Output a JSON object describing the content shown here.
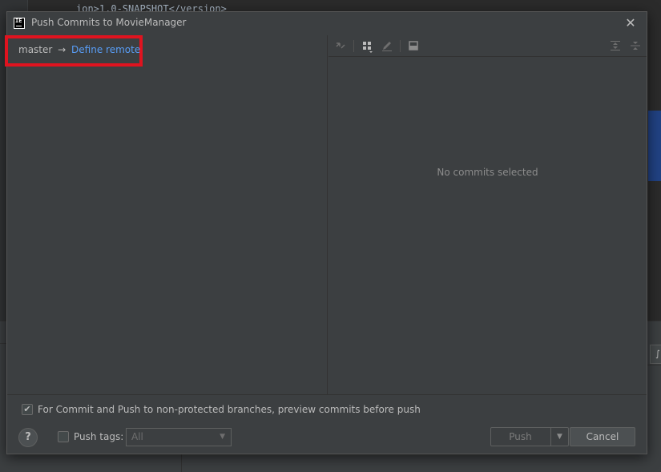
{
  "background": {
    "code_line": "ion>1.0-SNAPSHOT</version>"
  },
  "dialog": {
    "title": "Push Commits to MovieManager",
    "app_icon_text": "IE",
    "close_glyph": "✕"
  },
  "push_tree": {
    "branch": "master",
    "arrow": "→",
    "define_remote": "Define remote"
  },
  "details": {
    "empty_text": "No commits selected",
    "toolbar_icons": [
      "collapse-arrows-icon",
      "group-by-icon",
      "edit-icon",
      "preview-diff-icon",
      "expand-all-icon",
      "collapse-all-icon"
    ]
  },
  "options": {
    "preview_label": "For Commit and Push to non-protected branches, preview commits before push",
    "preview_checked": true,
    "push_tags_label": "Push tags:",
    "push_tags_checked": false,
    "push_tags_value": "All"
  },
  "buttons": {
    "help": "?",
    "push": "Push",
    "cancel": "Cancel"
  },
  "colors": {
    "dialog_bg": "#3c3f41",
    "link": "#589df6",
    "highlight": "#e0131f"
  }
}
